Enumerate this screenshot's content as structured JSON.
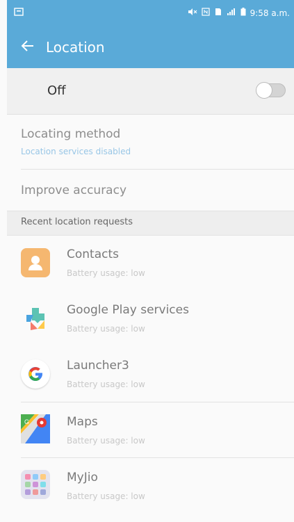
{
  "status": {
    "time": "9:58 a.m.",
    "icons": [
      "sim-icon",
      "mute-icon",
      "nfc-icon",
      "signal-icon",
      "battery-icon"
    ]
  },
  "appbar": {
    "title": "Location"
  },
  "master_switch": {
    "label": "Off",
    "state": "off"
  },
  "settings": [
    {
      "title": "Locating method",
      "subtitle": "Location services disabled"
    },
    {
      "title": "Improve accuracy"
    }
  ],
  "recent": {
    "header": "Recent location requests",
    "items": [
      {
        "name": "Contacts",
        "subtitle": "Battery usage: low"
      },
      {
        "name": "Google Play services",
        "subtitle": "Battery usage: low"
      },
      {
        "name": "Launcher3",
        "subtitle": "Battery usage: low"
      },
      {
        "name": "Maps",
        "subtitle": "Battery usage: low"
      },
      {
        "name": "MyJio",
        "subtitle": "Battery usage: low"
      }
    ]
  },
  "colors": {
    "primary": "#5aaad8",
    "accent_text": "#98c6e6"
  }
}
